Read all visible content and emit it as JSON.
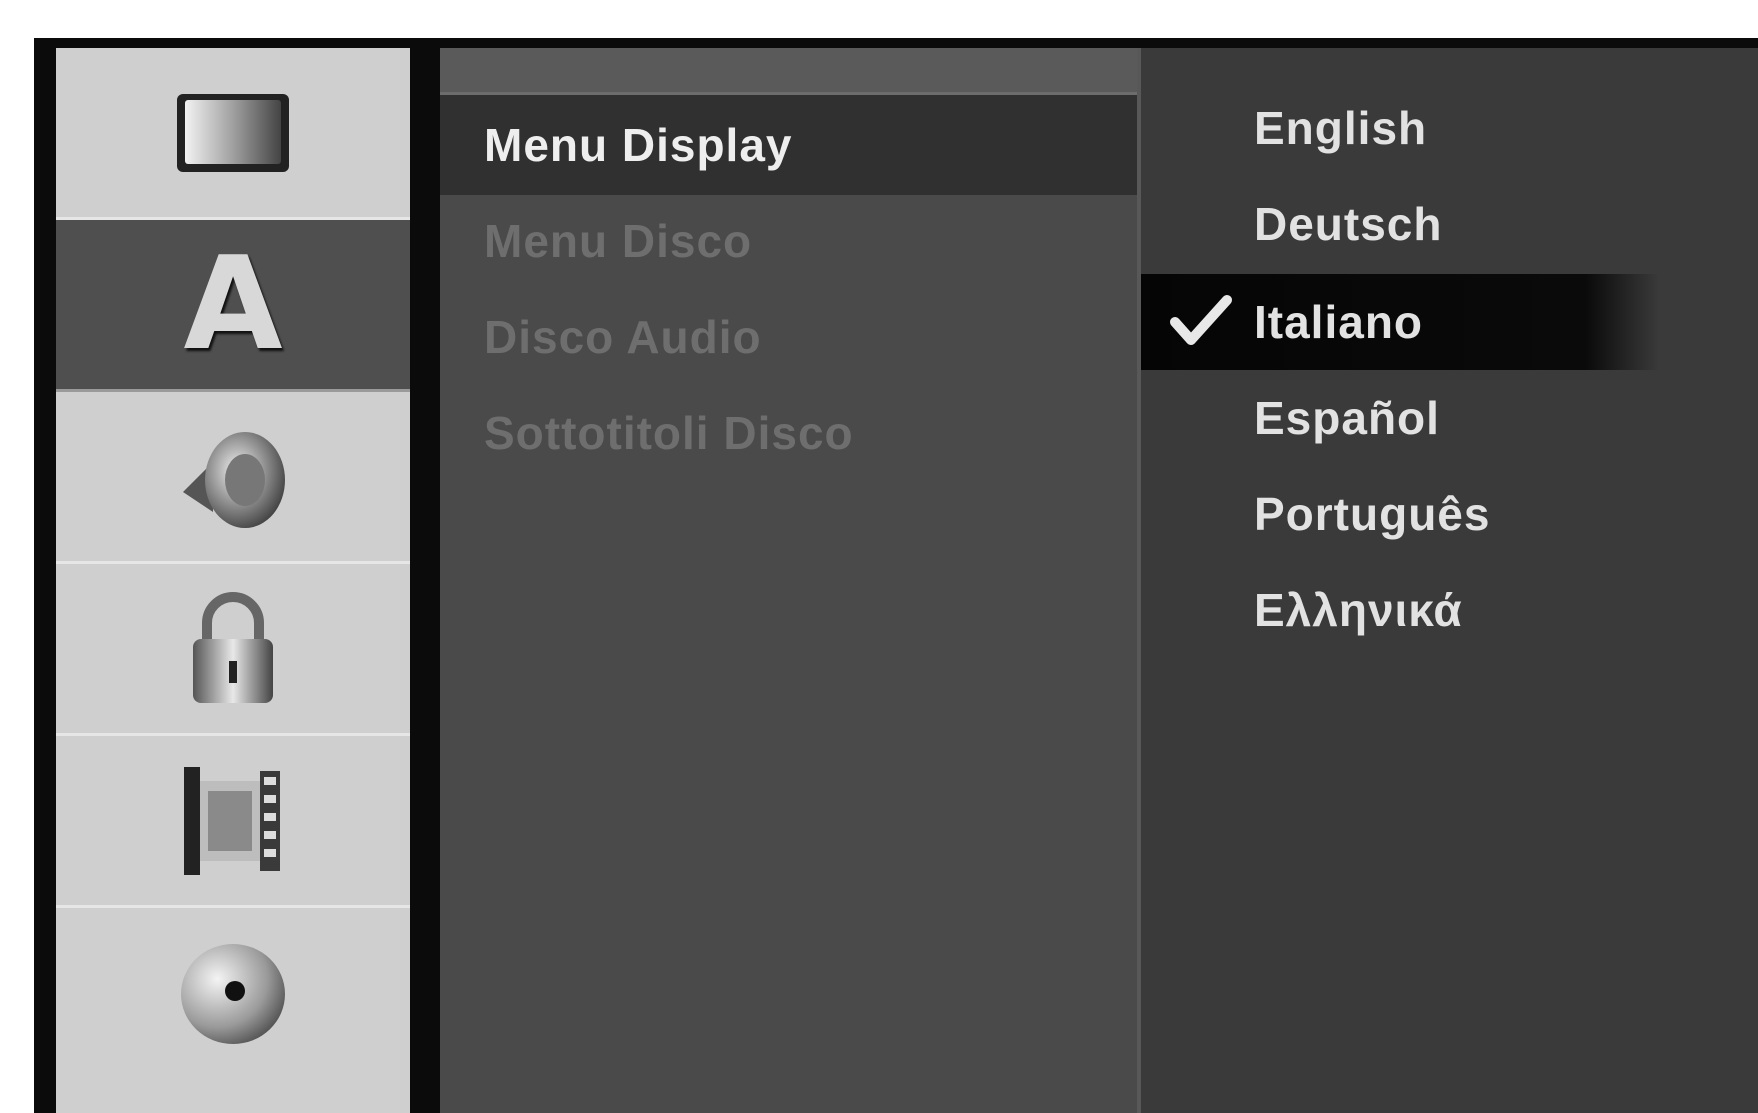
{
  "sidebar": {
    "items": [
      {
        "icon": "tv-screen-icon"
      },
      {
        "icon": "language-letter-icon",
        "label": "A",
        "active": true
      },
      {
        "icon": "speaker-icon"
      },
      {
        "icon": "padlock-icon"
      },
      {
        "icon": "film-strip-icon"
      },
      {
        "icon": "disc-icon"
      }
    ]
  },
  "menu": {
    "items": [
      {
        "label": "Menu Display",
        "selected": true
      },
      {
        "label": "Menu Disco"
      },
      {
        "label": "Disco Audio"
      },
      {
        "label": "Sottotitoli Disco"
      }
    ]
  },
  "options": {
    "items": [
      {
        "label": "English"
      },
      {
        "label": "Deutsch"
      },
      {
        "label": "Italiano",
        "checked": true
      },
      {
        "label": "Español"
      },
      {
        "label": "Português"
      },
      {
        "label": "Ελληνικά"
      }
    ]
  },
  "colors": {
    "sidebar_bg": "#cfcfcf",
    "sidebar_active": "#4f4f4f",
    "menu_bg": "#4a4a4a",
    "menu_selected": "#303030",
    "options_bg": "#3a3a3a",
    "text_bright": "#e2e2e2",
    "text_dim": "#6e6e6e"
  }
}
